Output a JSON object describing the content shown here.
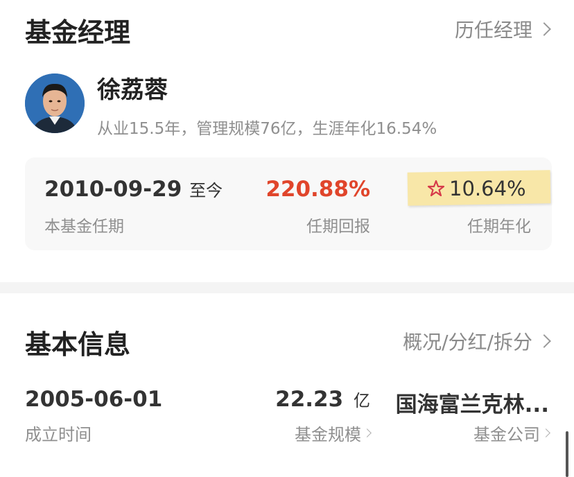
{
  "colors": {
    "return_red": "#e0452b",
    "sticky_yellow": "#f8e7a8",
    "star_red": "#d63a4a",
    "text_dark": "#222222",
    "text_grey": "#8f8f8f"
  },
  "manager_section": {
    "title": "基金经理",
    "history_link": "历任经理",
    "manager": {
      "name": "徐荔蓉",
      "summary": "从业15.5年，管理规模76亿，生涯年化16.54%",
      "avatar_icon": "manager-portrait"
    },
    "tenure": {
      "start_date": "2010-09-29",
      "until_now": "至今",
      "start_label": "本基金任期",
      "return_value": "220.88%",
      "return_label": "任期回报",
      "annualized_value": "10.64%",
      "annualized_label": "任期年化",
      "annualized_icon": "star-icon"
    }
  },
  "basic_info_section": {
    "title": "基本信息",
    "detail_link": "概况/分红/拆分",
    "items": [
      {
        "value": "2005-06-01",
        "unit": "",
        "label": "成立时间"
      },
      {
        "value": "22.23",
        "unit": "亿",
        "label": "基金规模"
      },
      {
        "value": "国海富兰克林...",
        "unit": "",
        "label": "基金公司"
      }
    ]
  }
}
